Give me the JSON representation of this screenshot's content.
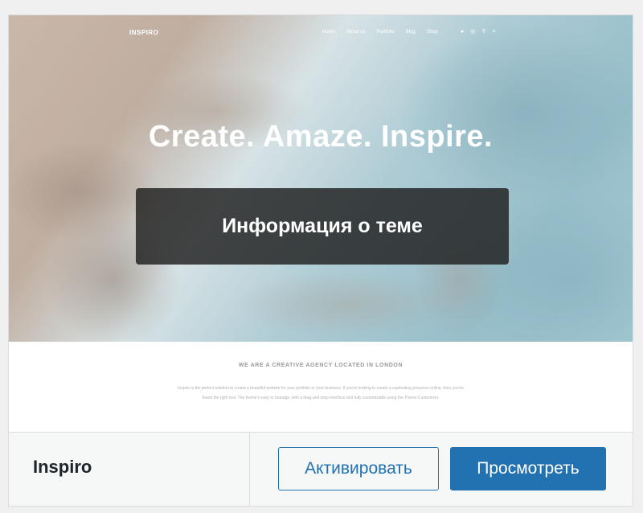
{
  "theme": {
    "name": "Inspiro",
    "details_label": "Информация о теме",
    "activate_label": "Активировать",
    "preview_label": "Просмотреть"
  },
  "screenshot": {
    "site_logo": "INSPIRO",
    "menu": [
      "Home",
      "About us",
      "Portfolio",
      "Blog",
      "Shop"
    ],
    "nav_icons": [
      "facebook-icon",
      "instagram-icon",
      "search-icon",
      "menu-icon"
    ],
    "hero_heading": "Create. Amaze. Inspire.",
    "agency_title": "WE ARE A CREATIVE AGENCY LOCATED IN LONDON",
    "agency_text": "Inspiro is the perfect solution to create a beautiful website for your portfolio or your business. If you're looking to create a captivating presence online, then you've found the right tool. The theme's easy to manage, with a drag-and-drop interface and fully customizable using the Theme Customizer."
  },
  "colors": {
    "accent": "#2271b1",
    "background": "#f0f0f1",
    "overlay": "#1e1e1e"
  }
}
